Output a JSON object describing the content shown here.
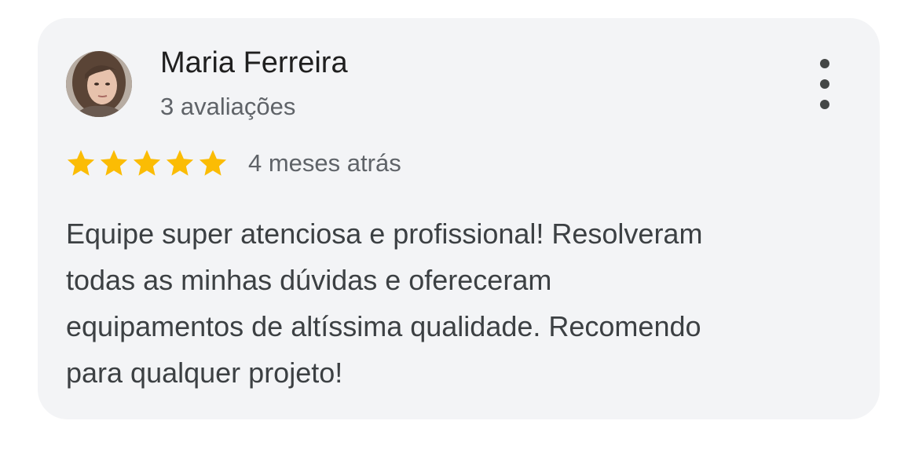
{
  "review": {
    "author": {
      "name": "Maria Ferreira",
      "reviews_count": "3 avaliações",
      "avatar": "profile-photo"
    },
    "rating": {
      "stars": 5,
      "max_stars": 5,
      "star_color": "#fbbc04"
    },
    "time_ago": "4 meses atrás",
    "text_lines": [
      "Equipe super atenciosa e profissional! Resolveram",
      "todas as minhas dúvidas e ofereceram",
      "equipamentos de altíssima qualidade. Recomendo",
      "para qualquer projeto!"
    ],
    "menu_icon": "more-vertical-icon"
  },
  "colors": {
    "card_background": "#f3f4f6",
    "name": "#1f1f1f",
    "secondary_text": "#5f6368",
    "body_text": "#3c4043"
  }
}
